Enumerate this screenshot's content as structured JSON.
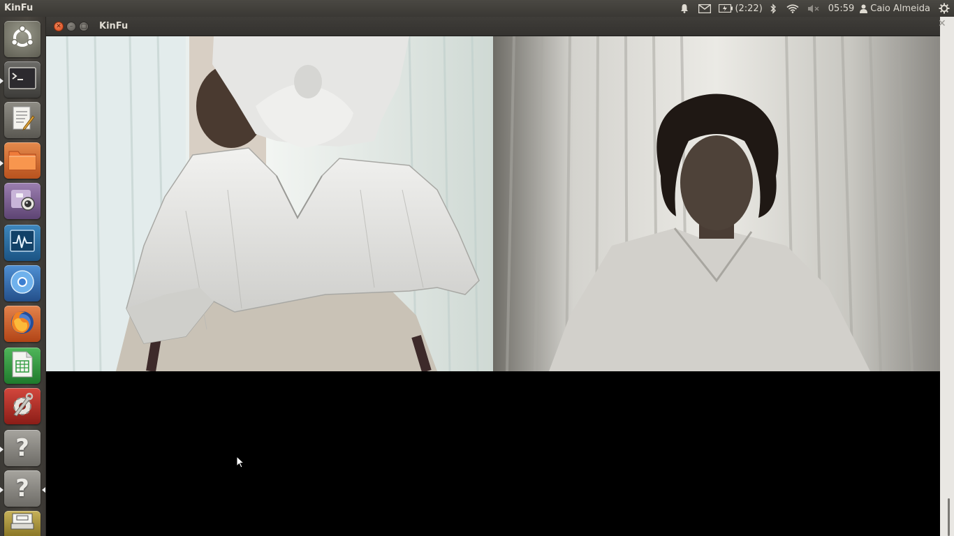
{
  "top_panel": {
    "app_title": "KinFu",
    "battery_text": "(2:22)",
    "clock": "05:59",
    "user_name": "Caio Almeida",
    "icons": [
      "bell-icon",
      "mail-icon",
      "battery-icon",
      "bluetooth-icon",
      "wifi-icon",
      "volume-muted-icon",
      "user-icon",
      "power-icon"
    ]
  },
  "launcher": {
    "items": [
      {
        "name": "dash-home",
        "icon": "ubuntu-logo-icon"
      },
      {
        "name": "terminal",
        "icon": "terminal-icon"
      },
      {
        "name": "text-editor",
        "icon": "text-editor-icon"
      },
      {
        "name": "files",
        "icon": "folder-icon"
      },
      {
        "name": "webcam",
        "icon": "webcam-icon"
      },
      {
        "name": "system-monitor",
        "icon": "system-monitor-icon"
      },
      {
        "name": "chromium",
        "icon": "chromium-icon"
      },
      {
        "name": "firefox",
        "icon": "firefox-icon"
      },
      {
        "name": "spreadsheet",
        "icon": "spreadsheet-icon"
      },
      {
        "name": "system-settings",
        "icon": "settings-icon"
      },
      {
        "name": "unknown-app-1",
        "icon": "question-icon"
      },
      {
        "name": "unknown-app-2",
        "icon": "question-icon"
      },
      {
        "name": "scanner",
        "icon": "scanner-icon"
      }
    ],
    "question_mark": "?"
  },
  "window": {
    "title": "KinFu",
    "left_view": "3d-reconstruction-view",
    "right_view": "camera-rgb-view"
  },
  "colors": {
    "panel_bg": "#3c3b37",
    "launcher_bg": "#423f3a",
    "close_button": "#e05a28",
    "window_bg": "#000000"
  }
}
